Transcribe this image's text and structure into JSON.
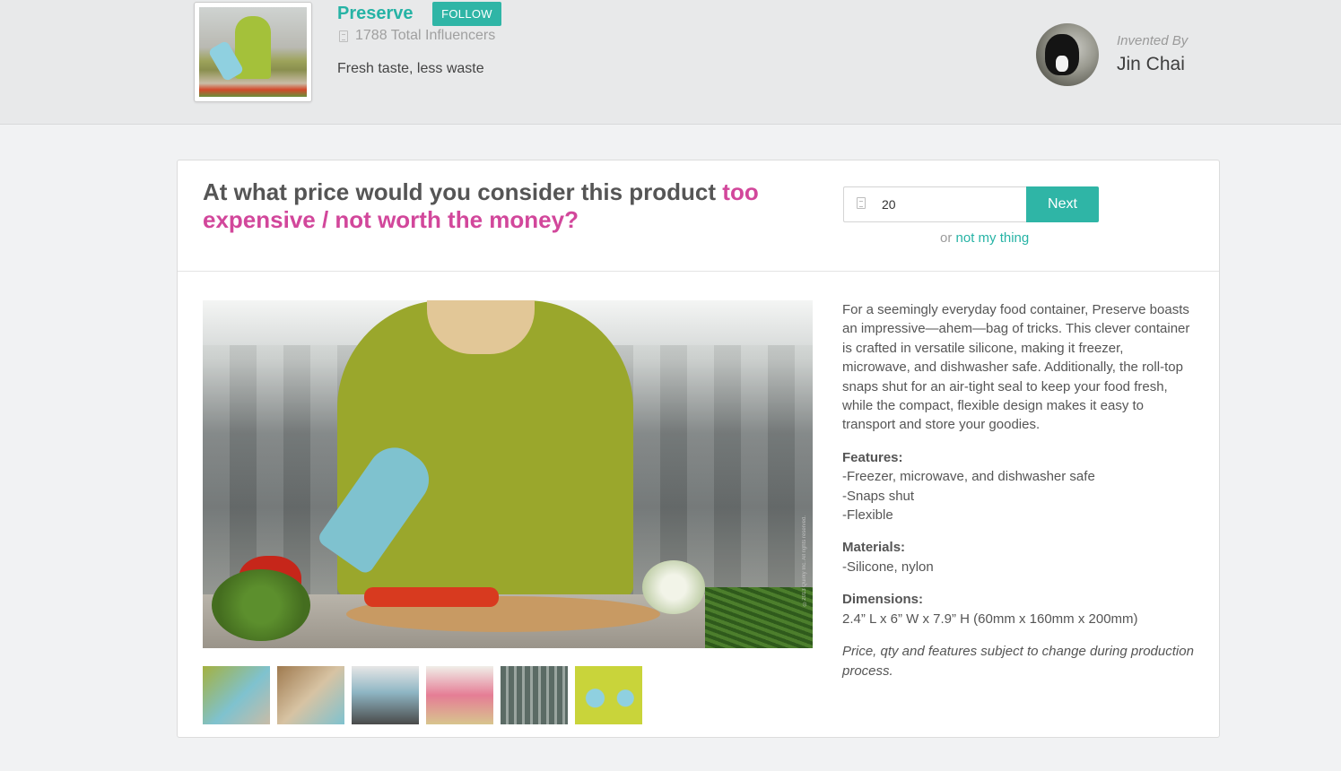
{
  "header": {
    "product_name": "Preserve",
    "follow_label": "FOLLOW",
    "influencers_text": "1788 Total Influencers",
    "tagline": "Fresh taste, less waste",
    "invented_by_label": "Invented By",
    "inventor_name": "Jin Chai"
  },
  "survey": {
    "question_plain": "At what price would you consider this product",
    "question_highlight": "too expensive / not worth the money?",
    "price_value": "20",
    "next_label": "Next",
    "alt_prefix": "or",
    "alt_link": "not my thing"
  },
  "gallery": {
    "copyright": "©2013 Quirky Inc. All rights reserved.",
    "thumbnails": [
      {
        "name": "woman-with-container",
        "color": "#a4b140"
      },
      {
        "name": "hand-opening-container",
        "color": "#9f7a4f"
      },
      {
        "name": "container-in-microwave",
        "color": "#8fb6c4"
      },
      {
        "name": "pink-containers",
        "color": "#e57d95"
      },
      {
        "name": "dishwasher-rack",
        "color": "#5b6b65"
      },
      {
        "name": "containers-on-lime",
        "color": "#c9d43a"
      }
    ]
  },
  "description": {
    "intro": "For a seemingly everyday food container, Preserve boasts an impressive—ahem—bag of tricks. This clever container is crafted in versatile silicone, making it freezer, microwave, and dishwasher safe. Additionally, the roll-top snaps shut for an air-tight seal to keep your food fresh, while the compact, flexible design makes it easy to transport and store your goodies.",
    "features_label": "Features:",
    "features": [
      "-Freezer, microwave, and dishwasher safe",
      "-Snaps shut",
      "-Flexible"
    ],
    "materials_label": "Materials:",
    "materials": "-Silicone, nylon",
    "dimensions_label": "Dimensions:",
    "dimensions": "2.4” L x 6” W x 7.9” H (60mm x 160mm x 200mm)",
    "note": "Price, qty and features subject to change during production process."
  },
  "colors": {
    "accent_teal": "#2fb5a6",
    "highlight_pink": "#d2479b"
  }
}
